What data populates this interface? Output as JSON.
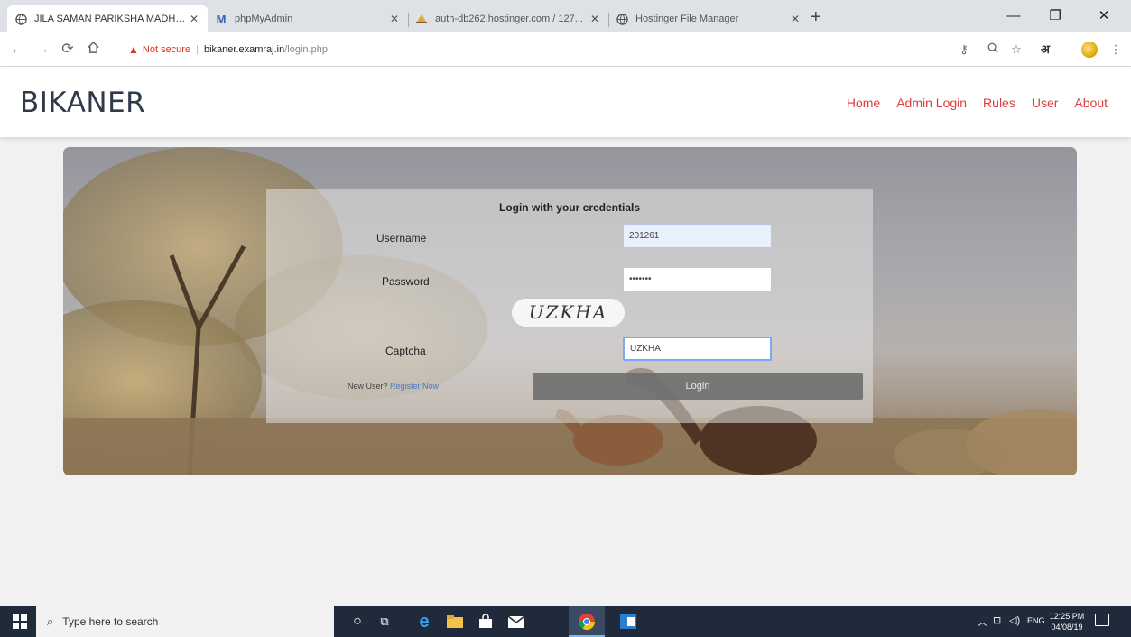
{
  "browser": {
    "tabs": [
      {
        "title": "JILA SAMAN PARIKSHA MADHY...",
        "active": true
      },
      {
        "title": "phpMyAdmin",
        "active": false
      },
      {
        "title": "auth-db262.hostinger.com / 127...",
        "active": false
      },
      {
        "title": "Hostinger File Manager",
        "active": false
      }
    ],
    "new_tab": "+",
    "address": {
      "security": "Not secure",
      "host": "bikaner.examraj.in",
      "path": "/login.php"
    },
    "profile_initial": "अ"
  },
  "site": {
    "brand": "BIKANER",
    "nav": [
      "Home",
      "Admin Login",
      "Rules",
      "User",
      "About"
    ]
  },
  "login": {
    "title": "Login with your credentials",
    "username_label": "Username",
    "username_value": "201261",
    "password_label": "Password",
    "password_value": "•••••••",
    "captcha_text": "UZKHA",
    "captcha_label": "Captcha",
    "captcha_value": "UZKHA",
    "button": "Login",
    "new_user_text": "New User?",
    "register_link": "Register Now"
  },
  "taskbar": {
    "search_placeholder": "Type here to search",
    "lang": "ENG",
    "time": "12:25 PM",
    "date": "04/08/19"
  },
  "colors": {
    "nav_link": "#e03c3c",
    "brand": "#2f3b4a",
    "taskbar": "#1f2a3a"
  }
}
